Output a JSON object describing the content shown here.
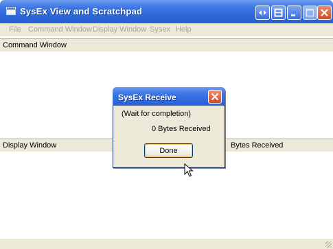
{
  "window": {
    "title": "SysEx View and Scratchpad",
    "icon": "app-window-icon",
    "controls": [
      "restore-arrows-icon",
      "tile-icon",
      "minimize-icon",
      "maximize-icon",
      "close-icon"
    ]
  },
  "menu": {
    "file": "File",
    "command_window": "Command Window",
    "display_window": "Display Window",
    "sysex": "Sysex",
    "help": "Help"
  },
  "command_pane": {
    "title": "Command Window"
  },
  "display_pane": {
    "title": "Display Window",
    "right_text": "Bytes Received"
  },
  "dialog": {
    "title": "SysEx Receive",
    "message": "(Wait for completion)",
    "count_text": "0  Bytes Received",
    "done_label": "Done"
  },
  "colors": {
    "titlebar": "#2c66d8",
    "chrome": "#ece9d8",
    "menu_disabled_text": "#a7a59a",
    "close_button": "#cf4a22"
  }
}
